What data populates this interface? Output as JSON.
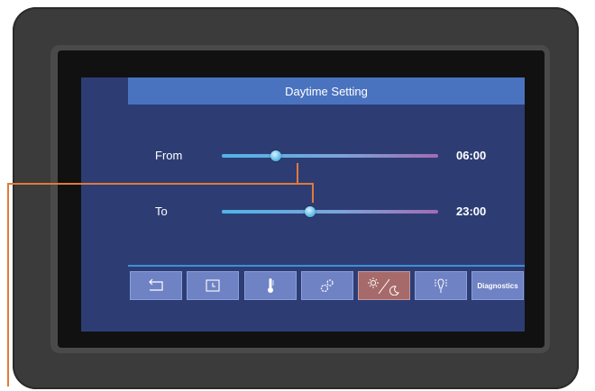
{
  "window": {
    "title": "Daytime Setting"
  },
  "rows": [
    {
      "label": "From",
      "value": "06:00",
      "level": 0.25
    },
    {
      "label": "To",
      "value": "23:00",
      "level": 0.41
    }
  ],
  "toolbar": {
    "items": [
      {
        "icon": "back-icon"
      },
      {
        "icon": "clock-icon"
      },
      {
        "icon": "thermometer-icon"
      },
      {
        "icon": "fan-settings-icon"
      },
      {
        "icon": "day-night-icon",
        "active": true
      },
      {
        "icon": "light-bulb-icon"
      },
      {
        "label": "Diagnostics"
      }
    ]
  },
  "colors": {
    "screen_bg": "#2d3d74",
    "title_bar": "#4a73bf",
    "button": "#6f82c4",
    "button_active": "#a66a6a",
    "callout": "#e07a3a"
  }
}
